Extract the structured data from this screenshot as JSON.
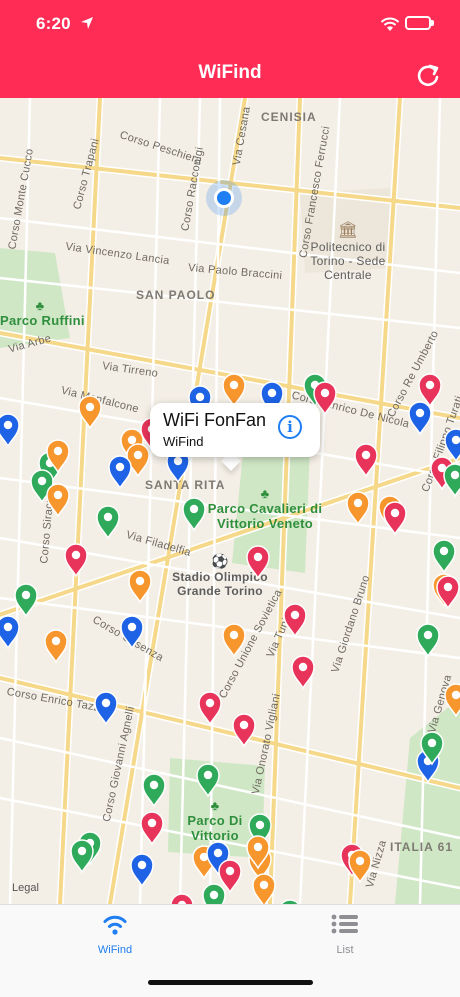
{
  "status": {
    "time": "6:20"
  },
  "nav": {
    "title": "WiFind",
    "refresh_icon": "refresh-icon"
  },
  "map": {
    "districts": [
      "CENISIA",
      "SAN PAOLO",
      "SANTA RITA",
      "ITALIA 61"
    ],
    "streets": [
      "Via Cesana",
      "Corso Peschiera",
      "Corso Trapani",
      "Corso Monte Cucco",
      "Corso Racconigi",
      "Corso Francesco Ferrucci",
      "Via Vincenzo Lancia",
      "Via Paolo Braccini",
      "Via Arbe",
      "Via Tirreno",
      "Via Monfalcone",
      "Corso Enrico De Nicola",
      "Corso Re Umberto",
      "Via Filadelfia",
      "Corso Siracusa",
      "Corso Cosenza",
      "Corso Enrico Tazzoli",
      "Corso Giovanni Agnelli",
      "Corso Unione Sovietica",
      "Via Tunisi",
      "Via Giordano Bruno",
      "Via Genova",
      "Via Nizza",
      "Via Onorato Vigliani",
      "Corso Filippo Turati"
    ],
    "parks": [
      "Parco Ruffini",
      "Parco Cavalieri di Vittorio Veneto",
      "Parco Di Vittorio"
    ],
    "pois": [
      "Politecnico di Torino - Sede Centrale",
      "Stadio Olimpico Grande Torino"
    ],
    "legal": "Legal"
  },
  "callout": {
    "title": "WiFi FonFan",
    "subtitle": "WiFind"
  },
  "colors": {
    "brand": "#ff2d55",
    "green": "#2faa5a",
    "orange": "#f7962d",
    "blue": "#1e63e6",
    "pink": "#e8345a"
  },
  "tabs": [
    {
      "label": "WiFind",
      "icon": "wifi-icon",
      "active": true
    },
    {
      "label": "List",
      "icon": "list-icon",
      "active": false
    }
  ]
}
